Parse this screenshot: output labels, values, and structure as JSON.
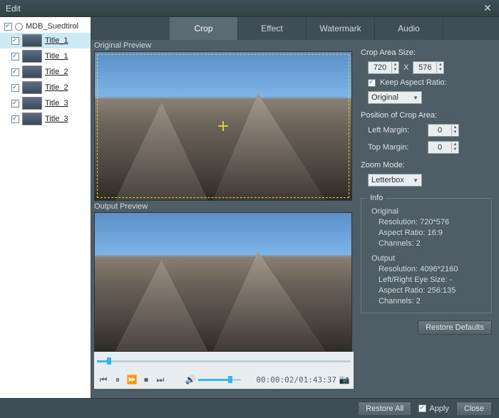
{
  "window": {
    "title": "Edit"
  },
  "sidebar": {
    "project": "MDB_Suedtirol",
    "items": [
      {
        "label": "Title_1",
        "selected": true
      },
      {
        "label": "Title_1",
        "selected": false
      },
      {
        "label": "Title_2",
        "selected": false
      },
      {
        "label": "Title_2",
        "selected": false
      },
      {
        "label": "Title_3",
        "selected": false
      },
      {
        "label": "Title_3",
        "selected": false
      }
    ]
  },
  "tabs": {
    "items": [
      "Crop",
      "Effect",
      "Watermark",
      "Audio"
    ],
    "active": 0
  },
  "preview": {
    "original_label": "Original Preview",
    "output_label": "Output Preview",
    "timecode": "00:00:02/01:43:37"
  },
  "crop": {
    "size_label": "Crop Area Size:",
    "width": "720",
    "sep": "X",
    "height": "576",
    "keep_aspect_label": "Keep Aspect Ratio:",
    "keep_aspect_checked": true,
    "aspect_value": "Original",
    "position_label": "Position of Crop Area:",
    "left_label": "Left Margin:",
    "left_value": "0",
    "top_label": "Top Margin:",
    "top_value": "0",
    "zoom_label": "Zoom Mode:",
    "zoom_value": "Letterbox"
  },
  "info": {
    "legend": "Info",
    "original_label": "Original",
    "orig_res_label": "Resolution:",
    "orig_res_value": "720*576",
    "orig_aspect_label": "Aspect Ratio:",
    "orig_aspect_value": "16:9",
    "orig_channels_label": "Channels:",
    "orig_channels_value": "2",
    "output_label": "Output",
    "out_res_label": "Resolution:",
    "out_res_value": "4096*2160",
    "out_eye_label": "Left/Right Eye Size:",
    "out_eye_value": "-",
    "out_aspect_label": "Aspect Ratio:",
    "out_aspect_value": "256:135",
    "out_channels_label": "Channels:",
    "out_channels_value": "2"
  },
  "buttons": {
    "restore_defaults": "Restore Defaults",
    "restore_all": "Restore All",
    "apply": "Apply",
    "close": "Close"
  }
}
